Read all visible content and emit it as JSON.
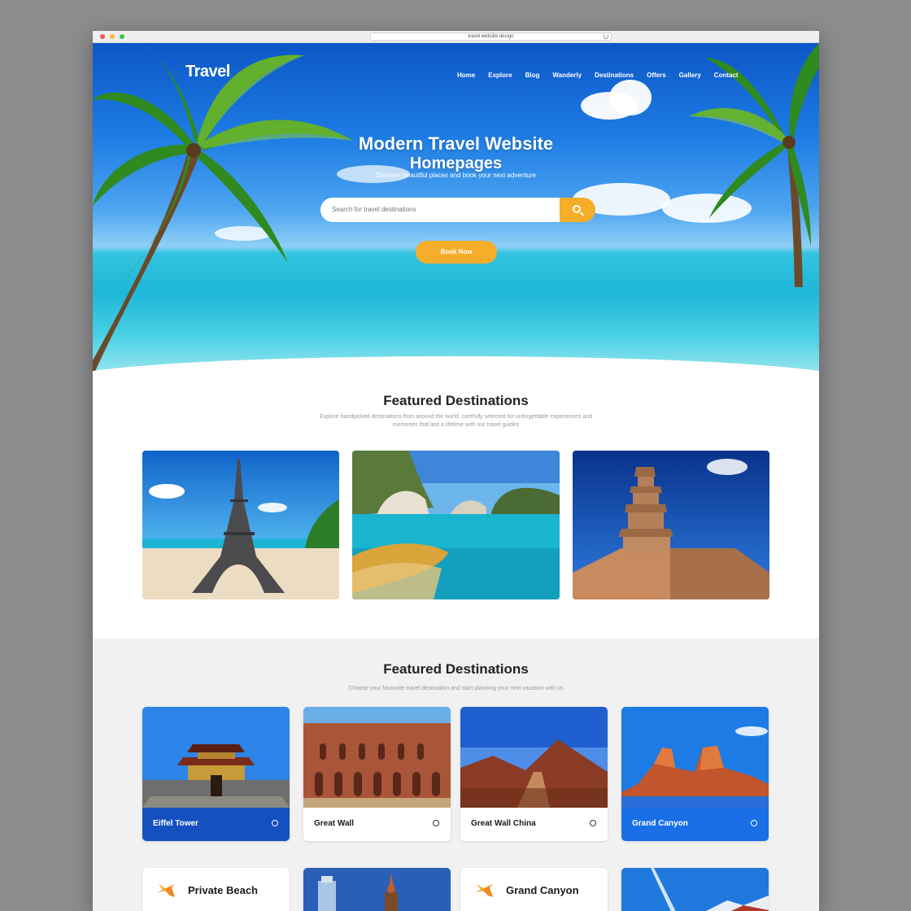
{
  "browser": {
    "url": "travel website design"
  },
  "brand": "Travel",
  "nav": [
    "Home",
    "Explore",
    "Blog",
    "Wanderly",
    "Destinations",
    "Offers",
    "Gallery",
    "Contact"
  ],
  "hero": {
    "title_line1": "Modern Travel Website",
    "title_line2": "Homepages",
    "subtitle": "Discover beautiful places and book your next adventure",
    "search_placeholder": "Search for travel destinations",
    "cta_label": "Book Now"
  },
  "featured1": {
    "title": "Featured Destinations",
    "text": "Explore handpicked destinations from around the world, carefully selected for unforgettable experiences and memories that last a lifetime with our travel guides"
  },
  "featured2": {
    "title": "Featured Destinations",
    "text": "Choose your favourite travel destination and start planning your next vacation with us",
    "cards": [
      {
        "label": "Eiffel Tower"
      },
      {
        "label": "Great Wall"
      },
      {
        "label": "Great Wall China"
      },
      {
        "label": "Grand Canyon"
      }
    ],
    "cards_row2": [
      {
        "label": "Private Beach"
      },
      {
        "label": ""
      },
      {
        "label": "Grand Canyon"
      },
      {
        "label": ""
      }
    ]
  },
  "colors": {
    "accent": "#f5ad2a",
    "brand_blue": "#1550c0",
    "ocean": "#1fb6d8"
  }
}
